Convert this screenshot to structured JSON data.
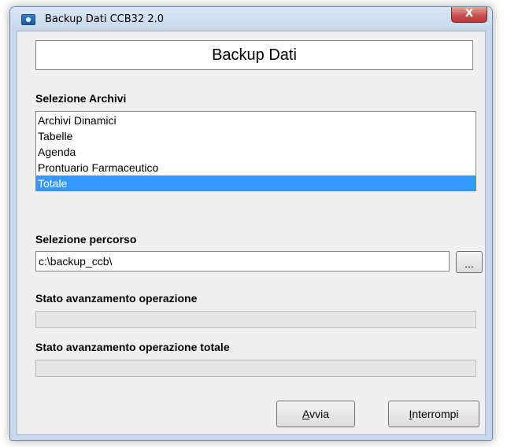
{
  "window": {
    "title": "Backup Dati CCB32 2.0",
    "close_glyph": "X"
  },
  "header": {
    "title": "Backup Dati"
  },
  "archives": {
    "label": "Selezione Archivi",
    "items": [
      {
        "label": "Archivi Dinamici",
        "selected": false
      },
      {
        "label": "Tabelle",
        "selected": false
      },
      {
        "label": "Agenda",
        "selected": false
      },
      {
        "label": "Prontuario Farmaceutico",
        "selected": false
      },
      {
        "label": "Totale",
        "selected": true
      }
    ]
  },
  "path": {
    "label": "Selezione percorso",
    "value": "c:\\backup_ccb\\",
    "browse_label": "..."
  },
  "progress_operation": {
    "label": "Stato avanzamento operazione",
    "percent": 0
  },
  "progress_total": {
    "label": "Stato avanzamento operazione totale",
    "percent": 0
  },
  "buttons": {
    "start_mnemonic": "A",
    "start_rest": "vvia",
    "stop_mnemonic": "I",
    "stop_rest": "nterrompi"
  },
  "colors": {
    "selection": "#3399ff",
    "titlebar": "#c9d9ec",
    "close_button": "#c75050"
  },
  "icons": {
    "app": "backup-app-icon",
    "close": "close-icon"
  }
}
